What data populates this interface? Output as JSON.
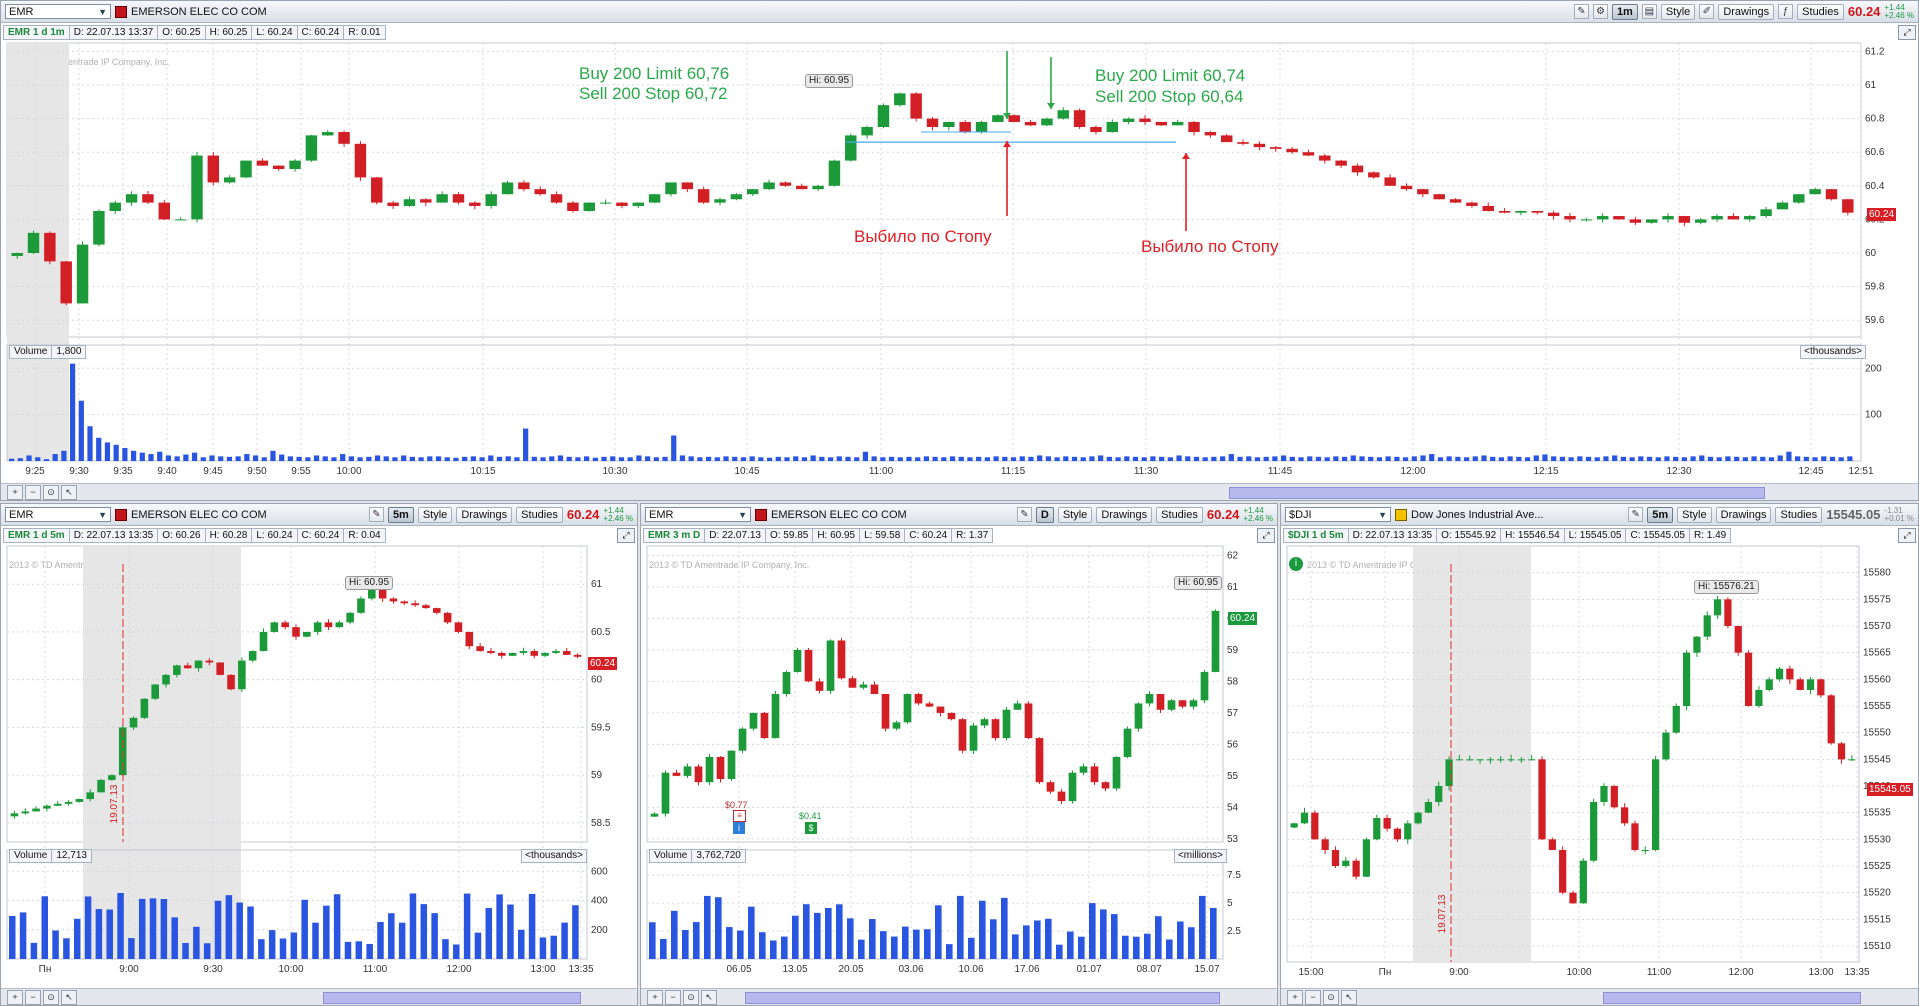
{
  "colors": {
    "up": "#1c9a3a",
    "down": "#d21f25",
    "volume": "#2a55e0",
    "accent_red": "#d0161b",
    "annotation_green": "#2aa84a",
    "annotation_red": "#e02025",
    "stop_line": "#4aa8e8"
  },
  "main": {
    "symbol": "EMR",
    "company": "EMERSON ELEC CO COM",
    "timeframe": "1m",
    "style": "Style",
    "drawings": "Drawings",
    "studies": "Studies",
    "last": "60.24",
    "chg_abs": "+1.44",
    "chg_pct": "+2.46 %",
    "info": {
      "label": "EMR 1 d 1m",
      "d": "D: 22.07.13 13:37",
      "o": "O: 60.25",
      "h": "H: 60.25",
      "l": "L: 60.24",
      "c": "C: 60.24",
      "r": "R: 0.01"
    },
    "copyright": "2013 © TD Ameritrade IP Company, Inc.",
    "hi_label": "Hi: 60.95",
    "annotations": {
      "buy1": "Buy 200 Limit 60,76",
      "sell1": "Sell 200 Stop 60,72",
      "buy2": "Buy 200 Limit 60,74",
      "sell2": "Sell 200 Stop 60,64",
      "stop1": "Выбило по Стопу",
      "stop2": "Выбило по Стопу"
    },
    "volume": {
      "label": "Volume",
      "value": "1,800",
      "units": "<thousands>"
    },
    "last_tag": "60.24"
  },
  "emr5": {
    "symbol": "EMR",
    "company": "EMERSON ELEC CO COM",
    "timeframe": "5m",
    "style": "Style",
    "drawings": "Drawings",
    "studies": "Studies",
    "last": "60.24",
    "chg_abs": "+1.44",
    "chg_pct": "+2.46 %",
    "info": {
      "label": "EMR 1 d 5m",
      "d": "D: 22.07.13 13:35",
      "o": "O: 60.26",
      "h": "H: 60.28",
      "l": "L: 60.24",
      "c": "C: 60.24",
      "r": "R: 0.04"
    },
    "copyright": "2013 © TD Ameritrade IP Company, Inc.",
    "hi_label": "Hi: 60.95",
    "date_marker": "19.07.13",
    "volume": {
      "label": "Volume",
      "value": "12,713",
      "units": "<thousands>"
    },
    "last_tag": "60.24"
  },
  "emr3m": {
    "symbol": "EMR",
    "company": "EMERSON ELEC CO COM",
    "timeframe": "D",
    "style": "Style",
    "drawings": "Drawings",
    "studies": "Studies",
    "last": "60.24",
    "chg_abs": "+1.44",
    "chg_pct": "+2.46 %",
    "info": {
      "label": "EMR 3 m D",
      "d": "D: 22.07.13",
      "o": "O: 59.85",
      "h": "H: 60.95",
      "l": "L: 59.58",
      "c": "C: 60.24",
      "r": "R: 1.37"
    },
    "copyright": "2013 © TD Ameritrade IP Company, Inc.",
    "hi_label": "Hi: 60.95",
    "dividend1": "$0.77",
    "dividend2": "$0.41",
    "volume": {
      "label": "Volume",
      "value": "3,762,720",
      "units": "<millions>"
    },
    "last_tag": "60.24"
  },
  "dji": {
    "symbol": "$DJI",
    "company": "Dow Jones Industrial Ave...",
    "timeframe": "5m",
    "style": "Style",
    "drawings": "Drawings",
    "studies": "Studies",
    "last": "15545.05",
    "chg_abs": "-1.31",
    "chg_pct": "+0.01 %",
    "info": {
      "label": "$DJI 1 d 5m",
      "d": "D: 22.07.13 13:35",
      "o": "O: 15545.92",
      "h": "H: 15546.54",
      "l": "L: 15545.05",
      "c": "C: 15545.05",
      "r": "R: 1.49"
    },
    "copyright": "2013 © TD Ameritrade IP Company, Inc.",
    "hi_label": "Hi: 15576.21",
    "date_marker": "19.07.13",
    "last_tag": "15545.05"
  },
  "chart_data": [
    {
      "id": "main_price",
      "type": "candlestick",
      "title": "EMR 1 d 1m",
      "x_ticks": [
        "9:25",
        "9:30",
        "9:35",
        "9:40",
        "9:45",
        "9:50",
        "9:55",
        "10:00",
        "10:15",
        "10:30",
        "10:45",
        "11:00",
        "11:15",
        "11:30",
        "11:45",
        "12:00",
        "12:15",
        "12:30",
        "12:45",
        "12:51"
      ],
      "y_ticks": [
        "59.6",
        "59.8",
        "60",
        "60.2",
        "60.4",
        "60.6",
        "60.8",
        "61",
        "61.2"
      ],
      "ylim": [
        59.5,
        61.25
      ],
      "series": [
        {
          "name": "close",
          "values": [
            60.0,
            60.12,
            59.95,
            59.7,
            60.05,
            60.25,
            60.3,
            60.35,
            60.3,
            60.2,
            60.2,
            60.58,
            60.42,
            60.45,
            60.55,
            60.52,
            60.5,
            60.55,
            60.7,
            60.72,
            60.65,
            60.45,
            60.3,
            60.28,
            60.32,
            60.3,
            60.35,
            60.3,
            60.28,
            60.35,
            60.42,
            60.38,
            60.35,
            60.3,
            60.25,
            60.3,
            60.3,
            60.28,
            60.3,
            60.35,
            60.42,
            60.38,
            60.3,
            60.32,
            60.35,
            60.38,
            60.42,
            60.4,
            60.38,
            60.4,
            60.55,
            60.7,
            60.75,
            60.88,
            60.95,
            60.8,
            60.75,
            60.78,
            60.72,
            60.78,
            60.82,
            60.78,
            60.76,
            60.8,
            60.85,
            60.75,
            60.72,
            60.78,
            60.8,
            60.78,
            60.76,
            60.78,
            60.72,
            60.7,
            60.66,
            60.65,
            60.63,
            60.62,
            60.6,
            60.58,
            60.55,
            60.52,
            60.48,
            60.45,
            60.4,
            60.38,
            60.35,
            60.32,
            60.3,
            60.28,
            60.25,
            60.24,
            60.25,
            60.24,
            60.22,
            60.2,
            60.2,
            60.22,
            60.2,
            60.18,
            60.2,
            60.22,
            60.18,
            60.2,
            60.22,
            60.2,
            60.22,
            60.26,
            60.3,
            60.35,
            60.38,
            60.32,
            60.24
          ]
        }
      ],
      "volume": {
        "ylim": [
          0,
          220
        ],
        "y_ticks": [
          "100",
          "200"
        ],
        "values": [
          5,
          6,
          12,
          8,
          4,
          15,
          22,
          210,
          130,
          75,
          50,
          40,
          35,
          28,
          22,
          18,
          15,
          20,
          12,
          10,
          14,
          18,
          8,
          12,
          10,
          9,
          10,
          15,
          12,
          8,
          22,
          14,
          10,
          9,
          8,
          12,
          10,
          8,
          15,
          10,
          8,
          9,
          12,
          10,
          8,
          12,
          9,
          8,
          10,
          10,
          8,
          7,
          9,
          10,
          8,
          12,
          9,
          10,
          8,
          70,
          9,
          8,
          10,
          12,
          9,
          8,
          10,
          7,
          9,
          10,
          8,
          8,
          12,
          10,
          8,
          9,
          55,
          12,
          10,
          8,
          9,
          8,
          10,
          9,
          8,
          10,
          8,
          7,
          9,
          8,
          10,
          8,
          12,
          9,
          8,
          10,
          9,
          8,
          20,
          10,
          8,
          9,
          8,
          9,
          8,
          10,
          9,
          8,
          10,
          9,
          8,
          9,
          8,
          10,
          9,
          8,
          10,
          9,
          12,
          10,
          8,
          10,
          9,
          8,
          10,
          12,
          9,
          8,
          10,
          9,
          8,
          10,
          9,
          8,
          12,
          10,
          9,
          8,
          9,
          10,
          15,
          9,
          10,
          8,
          9,
          10,
          12,
          9,
          8,
          10,
          9,
          8,
          10,
          9,
          12,
          10,
          9,
          8,
          10,
          9,
          8,
          10,
          12,
          15,
          8,
          10,
          9,
          8,
          10,
          12,
          9,
          8,
          10,
          9,
          8,
          12,
          14,
          10,
          9,
          8,
          10,
          9,
          8,
          10,
          12,
          9,
          8,
          10,
          9,
          8,
          10,
          9,
          8,
          10,
          12,
          9,
          8,
          10,
          9,
          8,
          10,
          9,
          8,
          12,
          20,
          10,
          9,
          8,
          10,
          9,
          8,
          10
        ]
      }
    },
    {
      "id": "emr_5m",
      "type": "candlestick",
      "title": "EMR 1 d 5m",
      "x_ticks": [
        "Пн",
        "9:00",
        "9:30",
        "10:00",
        "11:00",
        "12:00",
        "13:00",
        "13:35"
      ],
      "y_ticks": [
        "58.5",
        "59",
        "59.5",
        "60",
        "60.5",
        "61"
      ],
      "ylim": [
        58.3,
        61.4
      ],
      "series": [
        {
          "name": "close",
          "values": [
            58.6,
            58.62,
            58.65,
            58.68,
            58.7,
            58.72,
            58.75,
            58.82,
            58.95,
            59.0,
            59.5,
            59.6,
            59.8,
            59.95,
            60.05,
            60.15,
            60.12,
            60.2,
            60.18,
            60.05,
            59.9,
            60.2,
            60.3,
            60.5,
            60.6,
            60.55,
            60.45,
            60.5,
            60.6,
            60.55,
            60.6,
            60.7,
            60.85,
            60.95,
            60.85,
            60.82,
            60.8,
            60.78,
            60.75,
            60.7,
            60.6,
            60.5,
            60.35,
            60.3,
            60.28,
            60.25,
            60.28,
            60.3,
            60.25,
            60.28,
            60.3,
            60.26,
            60.24
          ]
        }
      ],
      "volume": {
        "ylim": [
          0,
          650
        ],
        "y_ticks": [
          "200",
          "400",
          "600"
        ]
      }
    },
    {
      "id": "emr_3m_daily",
      "type": "candlestick",
      "title": "EMR 3 m D",
      "x_ticks": [
        "06.05",
        "13.05",
        "20.05",
        "03.06",
        "10.06",
        "17.06",
        "01.07",
        "08.07",
        "15.07"
      ],
      "y_ticks": [
        "53",
        "54",
        "55",
        "56",
        "57",
        "58",
        "59",
        "60",
        "61",
        "62"
      ],
      "ylim": [
        52.9,
        62.3
      ],
      "series": [
        {
          "name": "close",
          "values": [
            53.8,
            55.1,
            55.0,
            55.3,
            54.8,
            55.6,
            54.9,
            55.8,
            56.5,
            57.0,
            56.2,
            57.6,
            58.3,
            59.0,
            58.0,
            57.7,
            59.3,
            58.1,
            57.8,
            57.9,
            57.6,
            56.5,
            56.7,
            57.6,
            57.3,
            57.2,
            57.0,
            56.8,
            55.8,
            56.6,
            56.8,
            56.2,
            57.1,
            57.3,
            56.2,
            54.8,
            54.5,
            54.2,
            55.1,
            55.3,
            54.8,
            54.6,
            55.6,
            56.5,
            57.3,
            57.6,
            57.1,
            57.4,
            57.2,
            57.4,
            58.3,
            60.24
          ]
        }
      ],
      "volume": {
        "ylim": [
          0,
          8.5
        ],
        "y_ticks": [
          "2.5",
          "5",
          "7.5"
        ]
      }
    },
    {
      "id": "dji_5m",
      "type": "candlestick",
      "title": "$DJI 1 d 5m",
      "x_ticks": [
        "15:00",
        "Пн",
        "9:00",
        "10:00",
        "11:00",
        "12:00",
        "13:00",
        "13:35"
      ],
      "y_ticks": [
        "15510",
        "15515",
        "15520",
        "15525",
        "15530",
        "15535",
        "15540",
        "15545",
        "15550",
        "15555",
        "15560",
        "15565",
        "15570",
        "15575",
        "15580"
      ],
      "ylim": [
        15507,
        15585
      ],
      "series": [
        {
          "name": "close",
          "values": [
            15533,
            15535,
            15530,
            15528,
            15525,
            15526,
            15523,
            15530,
            15534,
            15532,
            15530,
            15533,
            15535,
            15537,
            15540,
            15545,
            15545,
            15545,
            15545,
            15545,
            15545,
            15545,
            15545,
            15545,
            15530,
            15528,
            15520,
            15518,
            15526,
            15537,
            15540,
            15536,
            15533,
            15528,
            15528,
            15545,
            15550,
            15555,
            15565,
            15568,
            15572,
            15575,
            15570,
            15565,
            15555,
            15558,
            15560,
            15562,
            15560,
            15558,
            15560,
            15557,
            15548,
            15545,
            15545
          ]
        }
      ]
    }
  ]
}
